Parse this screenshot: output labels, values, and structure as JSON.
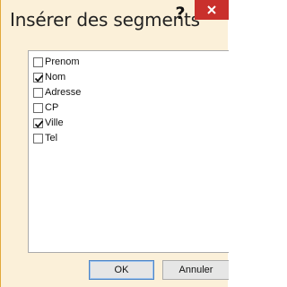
{
  "dialog": {
    "title": "Insérer des segments",
    "help_label": "?",
    "close_icon": "close-icon"
  },
  "fields": [
    {
      "label": "Prenom",
      "checked": false
    },
    {
      "label": "Nom",
      "checked": true
    },
    {
      "label": "Adresse",
      "checked": false
    },
    {
      "label": "CP",
      "checked": false
    },
    {
      "label": "Ville",
      "checked": true
    },
    {
      "label": "Tel",
      "checked": false
    }
  ],
  "buttons": {
    "ok_label": "OK",
    "cancel_label": "Annuler"
  },
  "colors": {
    "accent": "#e2a93b",
    "close": "#c9302c",
    "background": "#fbf0d9"
  }
}
